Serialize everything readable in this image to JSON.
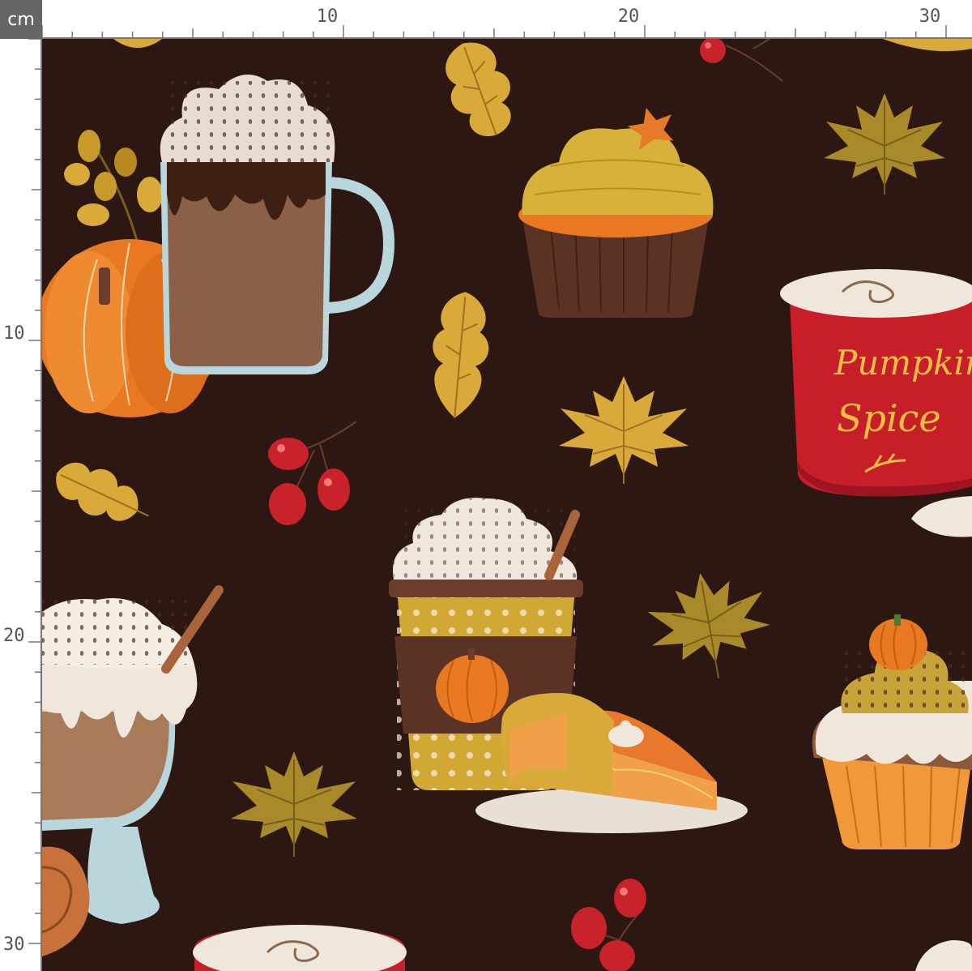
{
  "ruler": {
    "unit": "cm",
    "top_labels": [
      "10",
      "20",
      "30"
    ],
    "left_labels": [
      "10",
      "20",
      "30"
    ]
  },
  "can_label": {
    "line1": "Pumpkin",
    "line2": "Spice"
  },
  "colors": {
    "background": "#2c1712",
    "ruler_corner": "#666666",
    "leaf_yellow": "#d9a93a",
    "leaf_olive": "#a98a2a",
    "pumpkin_orange": "#e87822",
    "berry_red": "#c8222a",
    "can_red": "#c81e2a",
    "cream": "#efe6dc",
    "chocolate": "#5a3324"
  }
}
